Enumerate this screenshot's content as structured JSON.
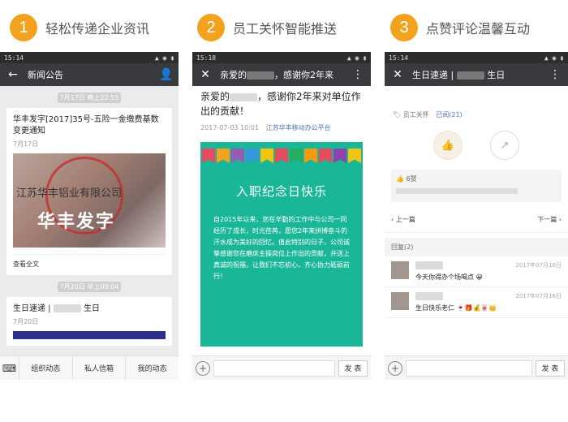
{
  "steps": [
    {
      "num": "1",
      "title": "轻松传递企业资讯"
    },
    {
      "num": "2",
      "title": "员工关怀智能推送"
    },
    {
      "num": "3",
      "title": "点赞评论温馨互动"
    }
  ],
  "phone1": {
    "time": "15:14",
    "title": "新闻公告",
    "date1": "7月17日 晚上22:55",
    "card1_title": "华丰发字[2017]35号-五险一金缴费基数变更通知",
    "card1_date": "7月17日",
    "card1_company": "江苏华丰铝业有限公司",
    "card1_img_text": "华丰发字",
    "card1_readmore": "查看全文",
    "date2": "7月20日 早上09:04",
    "card2_title_a": "生日速递 |",
    "card2_title_b": "生日",
    "card2_date": "7月20日",
    "nav": [
      "组织动态",
      "私人信箱",
      "我的动态"
    ]
  },
  "phone2": {
    "time": "15:18",
    "title_a": "亲爱的",
    "title_b": "，感谢你2年来",
    "art_title_a": "亲爱的",
    "art_title_b": "，感谢你2年来对单位作出的贡献！",
    "date": "2017-07-03 10:01",
    "account": "江苏华丰移动办公平台",
    "banner_title": "入职纪念日快乐",
    "banner_text": "自2015年以来，您在辛勤的工作中与公司一同经历了成长，时光荏苒，愿您2年来拼搏奋斗的汗水成为美好的回忆。值此特别的日子，公司诚挚感谢您在磨床主操岗位上作出的贡献，并送上真诚的祝福，让我们不忘初心，齐心协力砥砺前行！",
    "send": "发 表",
    "flag_colors": [
      "#e74c5e",
      "#f3a21e",
      "#9b59b6",
      "#3498db",
      "#f1c40f",
      "#e74c5e",
      "#27ae60",
      "#f39c12",
      "#e74c5e",
      "#8e44ad",
      "#f1c40f"
    ]
  },
  "phone3": {
    "time": "15:14",
    "title_a": "生日速递 |",
    "title_b": "生日",
    "tag": "员工关怀",
    "read": "已阅(21)",
    "likes": "6赞",
    "prev": "上一篇",
    "next": "下一篇",
    "reply_head": "回复(2)",
    "comments": [
      {
        "date": "2017年07月16日",
        "text": "今天你得办个场喝点 😀"
      },
      {
        "date": "2017年07月16日",
        "text": "生日快乐老仁 🍷🎁💰🀄👑"
      }
    ],
    "send": "发 表"
  }
}
